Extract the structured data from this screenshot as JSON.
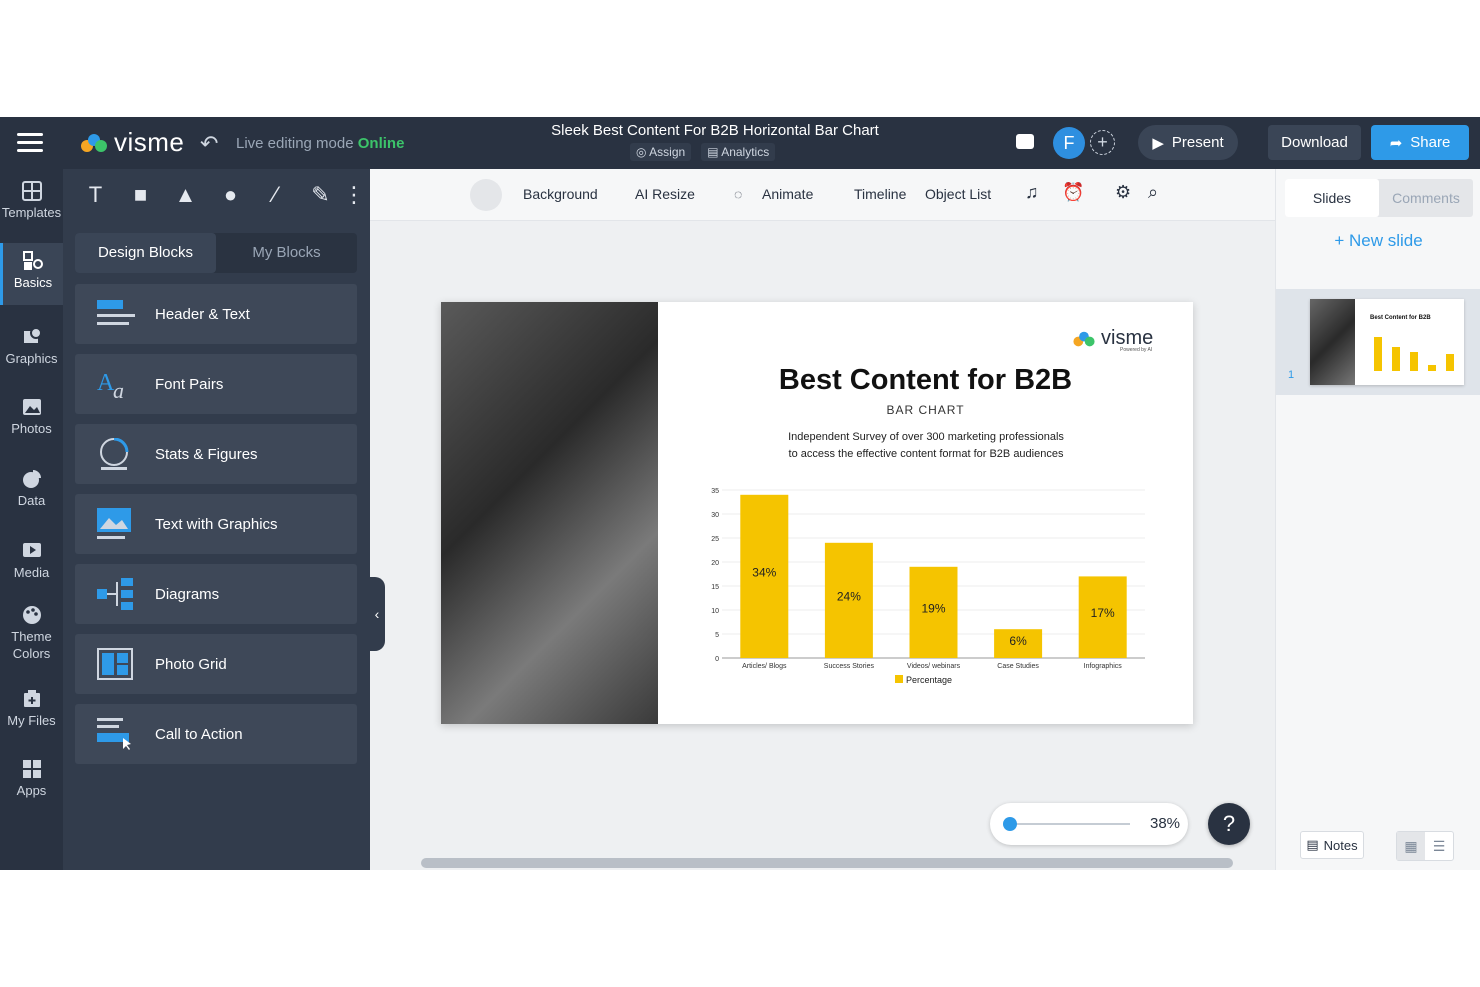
{
  "topbar": {
    "brand": "visme",
    "mode_prefix": "Live editing mode",
    "mode_status": "Online",
    "doc_title": "Sleek Best Content For B2B Horizontal Bar Chart",
    "assign": "Assign",
    "analytics": "Analytics",
    "avatar_initial": "F",
    "present": "Present",
    "download": "Download",
    "share": "Share"
  },
  "rail": [
    {
      "label": "Templates",
      "icon": "templates-icon"
    },
    {
      "label": "Basics",
      "icon": "basics-icon"
    },
    {
      "label": "Graphics",
      "icon": "graphics-icon"
    },
    {
      "label": "Photos",
      "icon": "photos-icon"
    },
    {
      "label": "Data",
      "icon": "pie-chart-icon"
    },
    {
      "label": "Media",
      "icon": "media-icon"
    },
    {
      "label": "Theme Colors",
      "icon": "palette-icon"
    },
    {
      "label": "My Files",
      "icon": "my-files-icon"
    },
    {
      "label": "Apps",
      "icon": "apps-grid-icon"
    }
  ],
  "panel": {
    "tool_text": "T",
    "tabs": [
      "Design Blocks",
      "My Blocks"
    ],
    "blocks": [
      "Header & Text",
      "Font Pairs",
      "Stats & Figures",
      "Text with Graphics",
      "Diagrams",
      "Photo Grid",
      "Call to Action"
    ]
  },
  "toolbar": {
    "background": "Background",
    "ai_resize": "AI Resize",
    "animate": "Animate",
    "timeline": "Timeline",
    "object_list": "Object List"
  },
  "slide": {
    "brand": "visme",
    "brand_sub": "Powered by AI",
    "title": "Best Content for B2B",
    "kicker": "BAR CHART",
    "desc_line1": "Independent Survey of over 300 marketing professionals",
    "desc_line2": "to access the effective content format for B2B audiences"
  },
  "chart_data": {
    "type": "bar",
    "categories": [
      "Articles/ Blogs",
      "Success Stories",
      "Videos/ webinars",
      "Case Studies",
      "Infographics"
    ],
    "values": [
      34,
      24,
      19,
      6,
      17
    ],
    "data_labels": [
      "34%",
      "24%",
      "19%",
      "6%",
      "17%"
    ],
    "series": [
      {
        "name": "Percentage",
        "values": [
          34,
          24,
          19,
          6,
          17
        ]
      }
    ],
    "yticks": [
      0,
      5,
      10,
      15,
      20,
      25,
      30,
      35
    ],
    "ylim": [
      0,
      35
    ],
    "color": "#f5c400",
    "legend_position": "bottom"
  },
  "rightpanel": {
    "tabs": [
      "Slides",
      "Comments"
    ],
    "new_slide": "+ New slide",
    "slide_number": "1",
    "thumb_title": "Best Content for B2B",
    "notes": "Notes"
  },
  "zoom": {
    "value": "38%",
    "level": 0.38
  },
  "help": "?"
}
